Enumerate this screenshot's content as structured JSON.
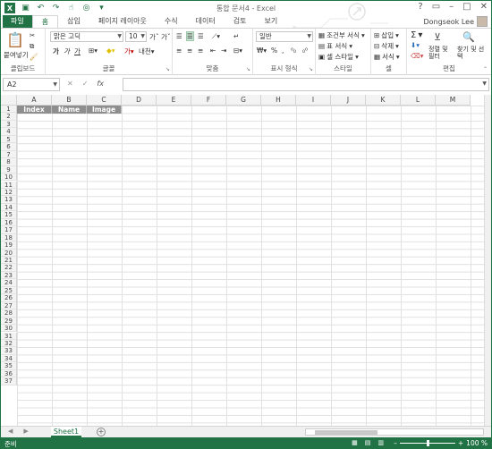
{
  "titlebar": {
    "title": "통합 문서4 - Excel",
    "win_help": "?",
    "win_restore": "▭",
    "win_min": "–",
    "win_max": "□",
    "win_close": "✕"
  },
  "tabs": [
    {
      "label": "파일"
    },
    {
      "label": "홈"
    },
    {
      "label": "삽입"
    },
    {
      "label": "페이지 레이아웃"
    },
    {
      "label": "수식"
    },
    {
      "label": "데이터"
    },
    {
      "label": "검토"
    },
    {
      "label": "보기"
    }
  ],
  "user": {
    "name": "Dongseok Lee"
  },
  "ribbon": {
    "clipboard": {
      "label": "클립보드",
      "paste": "붙여넣기"
    },
    "font": {
      "label": "글꼴",
      "name": "맑은 고딕",
      "size": "10"
    },
    "alignment": {
      "label": "맞춤"
    },
    "number": {
      "label": "표시 형식",
      "format": "일반",
      "percent": "%"
    },
    "styles": {
      "label": "스타일",
      "cond": "조건부 서식",
      "table": "표 서식",
      "cell": "셀 스타일"
    },
    "cells": {
      "label": "셀",
      "insert": "삽입",
      "delete": "삭제",
      "format": "서식"
    },
    "editing": {
      "label": "편집",
      "sort": "정렬 및 필터",
      "find": "찾기 및 선택",
      "sigma": "Σ"
    }
  },
  "formula": {
    "namebox": "A2",
    "cancel": "✕",
    "enter": "✓",
    "fx": "fx",
    "value": ""
  },
  "columns": [
    "A",
    "B",
    "C",
    "D",
    "E",
    "F",
    "G",
    "H",
    "I",
    "J",
    "K",
    "L",
    "M"
  ],
  "header_cells": [
    "Index",
    "Name",
    "Image"
  ],
  "rows": [
    1,
    2,
    3,
    4,
    5,
    6,
    7,
    8,
    9,
    10,
    11,
    12,
    13,
    14,
    15,
    16,
    17,
    18,
    19,
    20,
    21,
    22,
    23,
    24,
    25,
    26,
    27,
    28,
    29,
    30,
    31,
    32,
    33,
    34,
    35,
    36,
    37
  ],
  "sheets": [
    {
      "name": "Sheet1"
    }
  ],
  "status": {
    "text": "준비",
    "zoom": "100 %"
  },
  "colors": {
    "accent": "#217346",
    "header_fill": "#8e8e8e"
  }
}
